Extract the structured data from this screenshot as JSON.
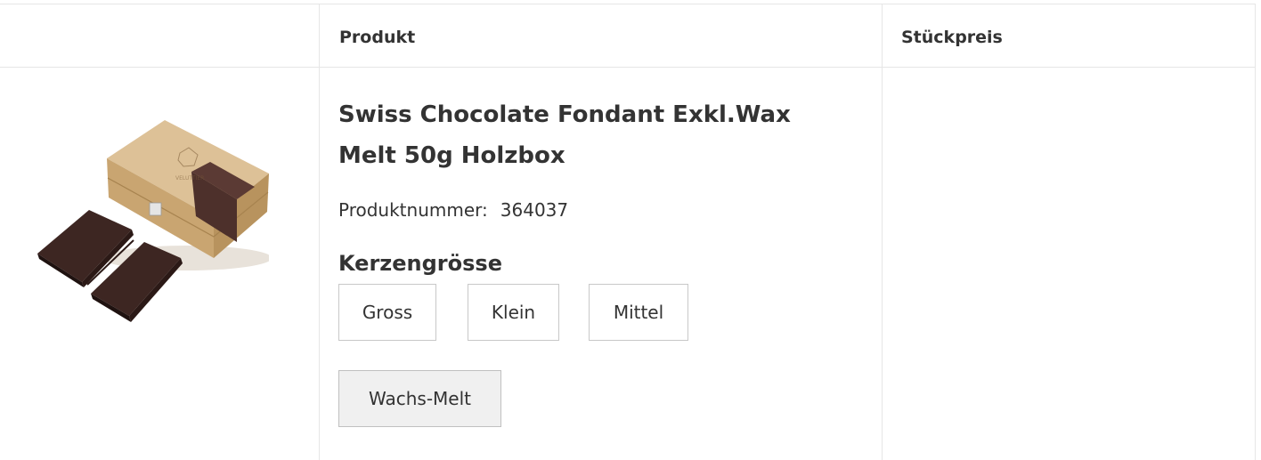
{
  "table": {
    "headers": {
      "image": "",
      "product": "Produkt",
      "price": "Stückpreis"
    }
  },
  "product": {
    "title": "Swiss Chocolate Fondant Exkl.Wax Melt 50g Holzbox",
    "sku_label": "Produktnummer:",
    "sku_value": "364037",
    "image_icon": "product-photo",
    "image_brand_text": "VELUTTIER",
    "price": ""
  },
  "options": {
    "heading": "Kerzengrösse",
    "values": [
      "Gross",
      "Klein",
      "Mittel",
      "Wachs-Melt"
    ],
    "selected": "Wachs-Melt"
  },
  "colors": {
    "text": "#333333",
    "border": "#e6e6e6",
    "option_border": "#c8c8c8",
    "selected_bg": "#f0f0f0",
    "wood": "#d8b88a",
    "chocolate": "#3a2420"
  }
}
